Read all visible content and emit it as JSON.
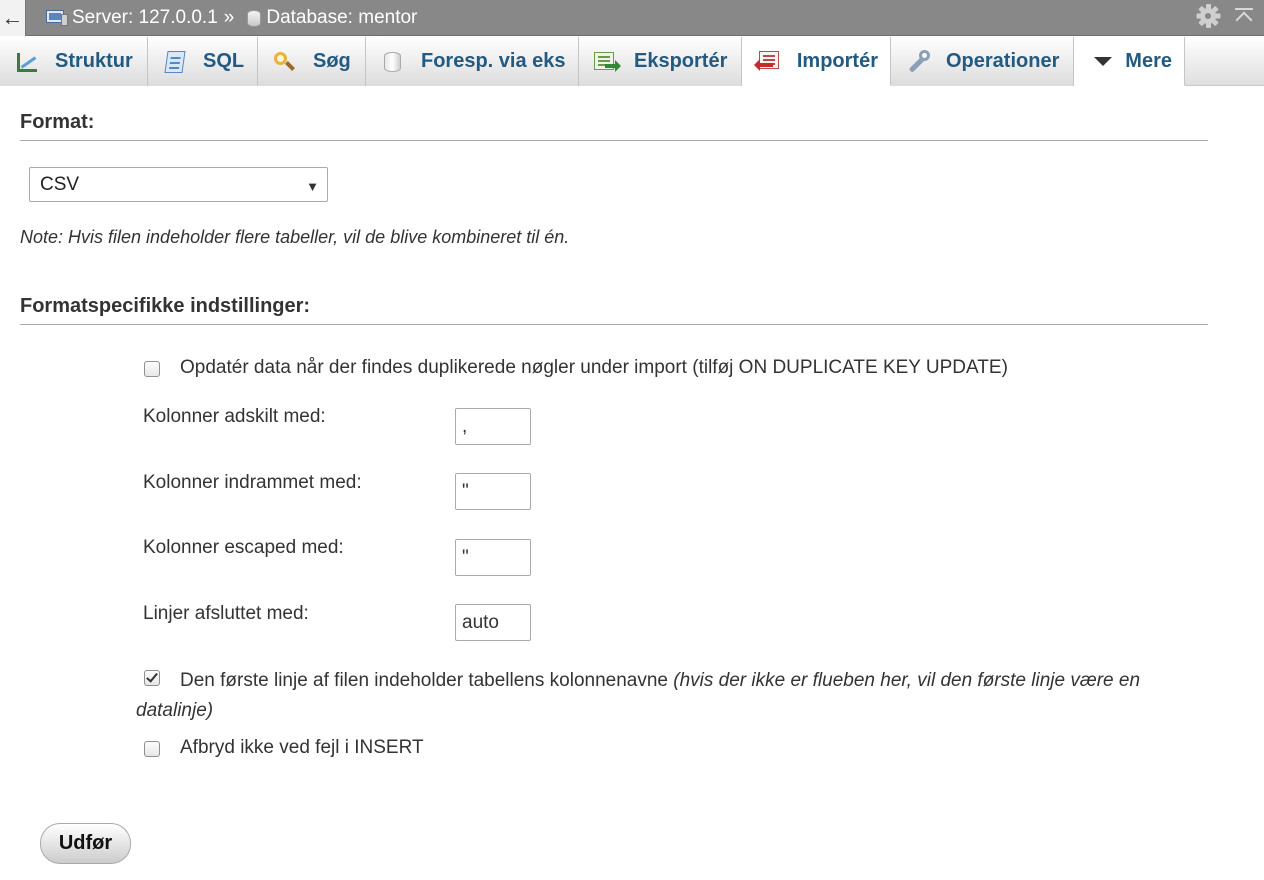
{
  "breadcrumb": {
    "back_glyph": "←",
    "server_label": "Server: 127.0.0.1",
    "separator": "»",
    "database_label": "Database: mentor"
  },
  "tabs": [
    {
      "label": "Struktur",
      "icon": "structure-icon"
    },
    {
      "label": "SQL",
      "icon": "sql-icon"
    },
    {
      "label": "Søg",
      "icon": "search-icon"
    },
    {
      "label": "Foresp. via eks",
      "icon": "query-icon"
    },
    {
      "label": "Eksportér",
      "icon": "export-icon"
    },
    {
      "label": "Importér",
      "icon": "import-icon",
      "active": true
    },
    {
      "label": "Operationer",
      "icon": "wrench-icon"
    },
    {
      "label": "Mere",
      "icon": "triangle-down-icon"
    }
  ],
  "format": {
    "heading": "Format:",
    "selected": "CSV",
    "caret": "▼",
    "note": "Note: Hvis filen indeholder flere tabeller, vil de blive kombineret til én."
  },
  "format_options": {
    "heading": "Formatspecifikke indstillinger:",
    "duplicate_key_label": "Opdatér data når der findes duplikerede nøgler under import (tilføj ON DUPLICATE KEY UPDATE)",
    "duplicate_key_checked": false,
    "separated_label": "Kolonner adskilt med:",
    "separated_value": ",",
    "enclosed_label": "Kolonner indrammet med:",
    "enclosed_value": "\"",
    "escaped_label": "Kolonner escaped med:",
    "escaped_value": "\"",
    "terminated_label": "Linjer afsluttet med:",
    "terminated_value": "auto",
    "first_line_label": "Den første linje af filen indeholder tabellens kolonnenavne",
    "first_line_hint": "(hvis der ikke er flueben her, vil den første linje være en datalinje)",
    "first_line_checked": true,
    "no_abort_label": "Afbryd ikke ved fejl i INSERT",
    "no_abort_checked": false
  },
  "submit_label": "Udfør",
  "colors": {
    "topbar": "#888888",
    "tab_text": "#235a81"
  }
}
